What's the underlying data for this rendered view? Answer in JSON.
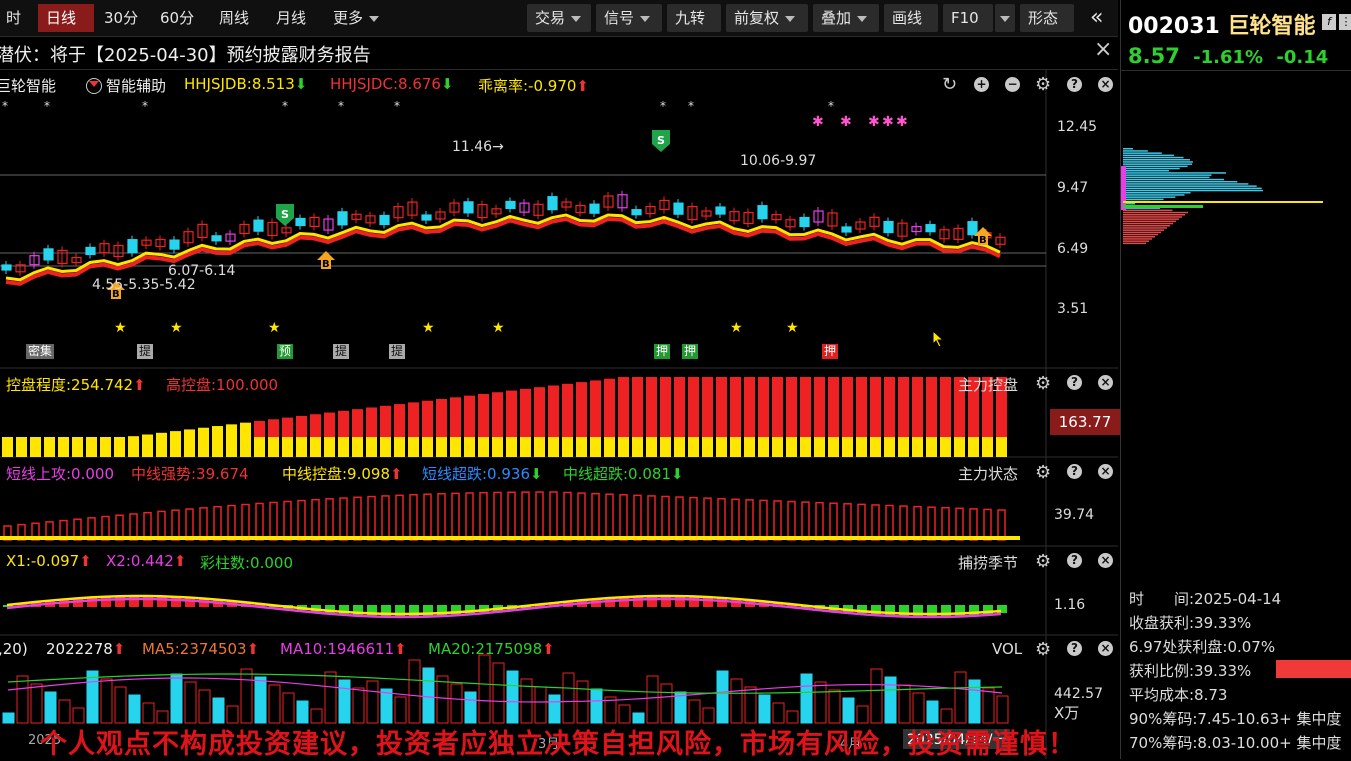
{
  "toolbar": {
    "left_cut": "时",
    "periods": [
      "日线",
      "30分",
      "60分",
      "周线",
      "月线",
      "更多"
    ],
    "right_buttons": [
      "交易",
      "信号",
      "九转",
      "前复权",
      "叠加",
      "画线",
      "F10",
      "形态"
    ],
    "collapse": "«"
  },
  "notice": {
    "text": "潜伏：将于【2025-04-30】预约披露财务报告",
    "close": "×"
  },
  "stock": {
    "code": "002031",
    "name": "巨轮智能",
    "price": "8.57",
    "change_pct": "-1.61%",
    "change": "-0.14"
  },
  "main_chart": {
    "legend": {
      "name": "巨轮智能",
      "assist": "智能辅助",
      "hhjsjdb": "HHJSJDB:8.513",
      "hhjsjdc": "HHJSJDC:8.676",
      "deviation": "乖离率:-0.970"
    },
    "y_ticks": [
      "12.45",
      "9.47",
      "6.49",
      "3.51"
    ],
    "annotations": {
      "high": "11.46→",
      "range_top": "10.06-9.97",
      "range_mid": "6.07-6.14",
      "range_low": "4.55-5.35-5.42"
    },
    "tags": [
      "密集",
      "提",
      "预",
      "提",
      "提",
      "押",
      "押",
      "押"
    ]
  },
  "panel_kpd": {
    "legend1": "控盘程度:254.742",
    "legend2": "高控盘:100.000",
    "title": "主力控盘",
    "value_box": "163.77"
  },
  "panel_zlzt": {
    "l1": "短线上攻:0.000",
    "l2": "中线强势:39.674",
    "l3": "中线控盘:9.098",
    "l4": "短线超跌:0.936",
    "l5": "中线超跌:0.081",
    "title": "主力状态",
    "y_tick": "39.74"
  },
  "panel_season": {
    "l1": "X1:-0.097",
    "l2": "X2:0.442",
    "l3": "彩柱数:0.000",
    "title": "捕捞季节",
    "y_tick": "1.16"
  },
  "panel_vol": {
    "l0": ",20)",
    "l1": "2022278",
    "l2": "MA5:2374503",
    "l3": "MA10:1946611",
    "l4": "MA20:2175098",
    "title": "VOL",
    "y_tick": "442.57",
    "unit": "X万",
    "x_labels": [
      "2025",
      "3月",
      "4月",
      "2025/04/14/一"
    ]
  },
  "right_info": {
    "time": "时　　间:2025-04-14",
    "profit": "收盘获利:39.33%",
    "profit_at": "6.97处获利盘:0.07%",
    "ratio": "获利比例:39.33%",
    "avg_cost": "平均成本:8.73",
    "chip90": "90%筹码:7.45-10.63+ 集中度",
    "chip70": "70%筹码:8.03-10.00+ 集中度"
  },
  "colors": {
    "red": "#ee2222",
    "yellow": "#ffe600",
    "cyan": "#27d4ee",
    "magenta": "#e83ee8",
    "green": "#2dd12d",
    "accent_bg": "#8a1b1b"
  },
  "disclaimer": "个人观点不构成投资建议，投资者应独立决策自担风险，市场有风险，投资需谨慎！"
}
